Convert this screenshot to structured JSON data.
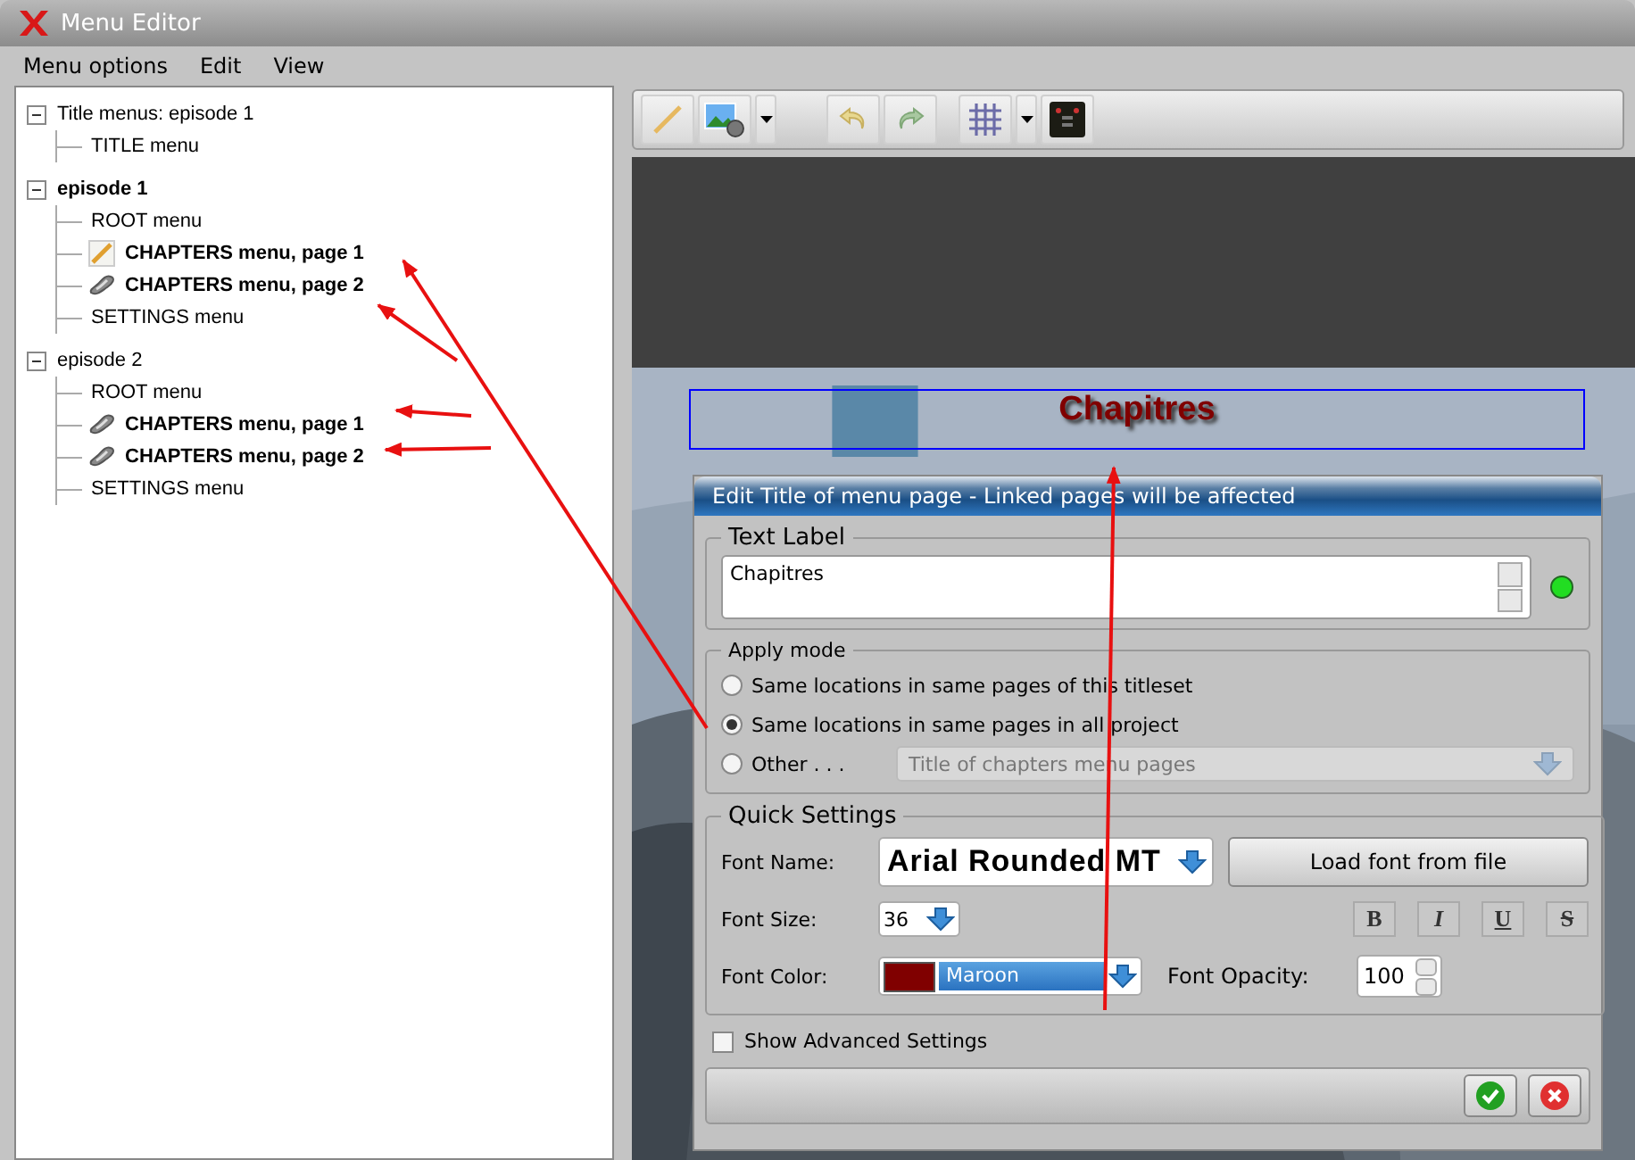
{
  "window": {
    "title": "Menu Editor"
  },
  "menu_bar": [
    "Menu options",
    "Edit",
    "View"
  ],
  "tree": [
    {
      "label": "Title menus: episode 1",
      "bold": false,
      "expanded": true,
      "children": [
        {
          "label": "TITLE menu",
          "bold": false
        }
      ]
    },
    {
      "label": "episode 1",
      "bold": true,
      "expanded": true,
      "children": [
        {
          "label": "ROOT menu",
          "bold": false
        },
        {
          "label": "CHAPTERS menu, page 1",
          "bold": true,
          "kind": "edit"
        },
        {
          "label": "CHAPTERS menu, page 2",
          "bold": true,
          "kind": "linked"
        },
        {
          "label": "SETTINGS menu",
          "bold": false
        }
      ]
    },
    {
      "label": "episode 2",
      "bold": false,
      "expanded": true,
      "children": [
        {
          "label": "ROOT menu",
          "bold": false
        },
        {
          "label": "CHAPTERS menu, page 1",
          "bold": true,
          "kind": "linked"
        },
        {
          "label": "CHAPTERS menu, page 2",
          "bold": true,
          "kind": "linked"
        },
        {
          "label": "SETTINGS menu",
          "bold": false
        }
      ]
    }
  ],
  "preview": {
    "title_text": "Chapitres",
    "kind": "picture"
  },
  "dialog": {
    "title": "Edit Title of menu page - Linked pages will be affected",
    "text_label": {
      "legend": "Text Label",
      "value": "Chapitres"
    },
    "apply_mode": {
      "legend": "Apply mode",
      "options": [
        {
          "label": "Same locations in same pages of this titleset",
          "selected": false
        },
        {
          "label": "Same locations in same pages in all project",
          "selected": true
        },
        {
          "label": "Other . . .",
          "selected": false
        }
      ],
      "other_placeholder": "Title of chapters menu pages"
    },
    "quick_settings": {
      "legend": "Quick Settings",
      "font_name_label": "Font Name:",
      "font_name": "Arial Rounded MT",
      "load_button": "Load font from file",
      "font_size_label": "Font Size:",
      "font_size": "36",
      "format_buttons": [
        "B",
        "I",
        "U",
        "S"
      ],
      "font_color_label": "Font Color:",
      "font_color": {
        "name": "Maroon",
        "color": "#800000"
      },
      "opacity_label": "Font Opacity:",
      "opacity": "100"
    },
    "advanced": {
      "label": "Show Advanced Settings",
      "checked": false
    }
  }
}
